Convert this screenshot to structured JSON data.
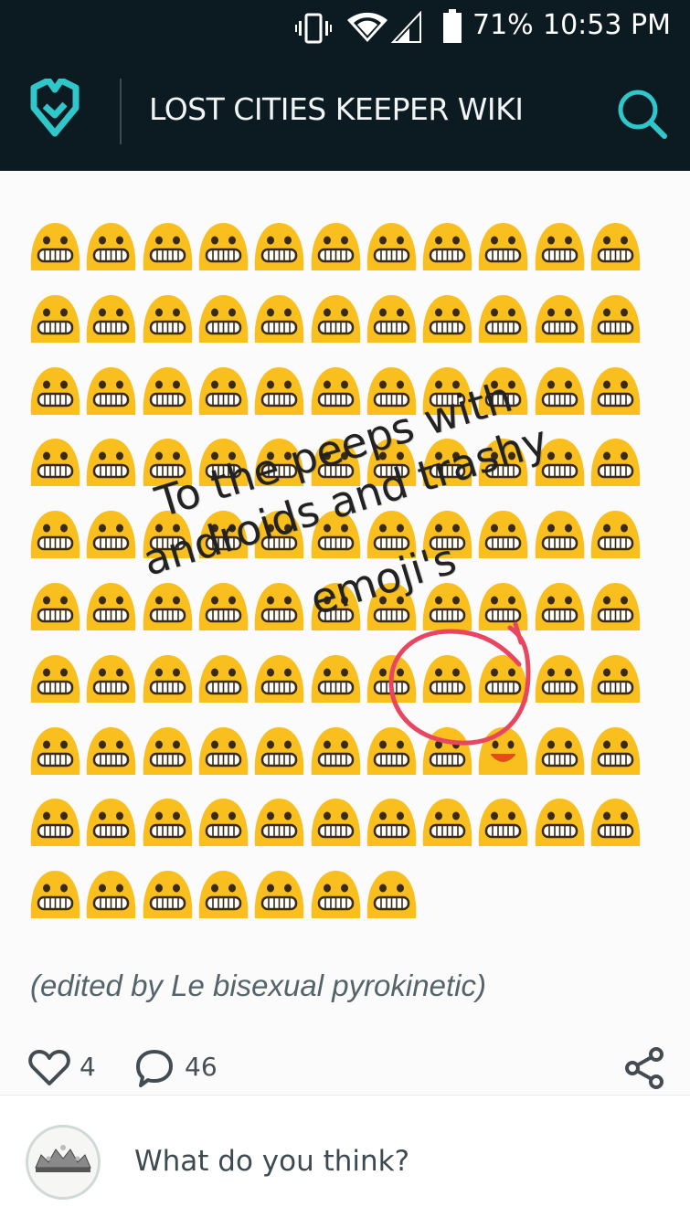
{
  "status": {
    "battery": "71%",
    "time": "10:53 PM"
  },
  "header": {
    "title": "LOST CITIES KEEPER WIKI"
  },
  "post": {
    "overlay_lines": [
      "To the peeps with",
      "androids and trashy",
      "emoji's"
    ],
    "emoji_rows": [
      11,
      11,
      11,
      11,
      11,
      11,
      11,
      11,
      11,
      7
    ],
    "highlighted_emoji": {
      "row": 7,
      "col": 8,
      "type": "smile"
    },
    "edited_note": "(edited by Le bisexual pyrokinetic)"
  },
  "actions": {
    "likes": "4",
    "comments": "46"
  },
  "comment": {
    "placeholder": "What do you think?"
  },
  "colors": {
    "accent": "#2fc7c9",
    "header_bg": "#0c1a22",
    "emoji": "#f9bf1e",
    "circle": "#e8455f"
  }
}
